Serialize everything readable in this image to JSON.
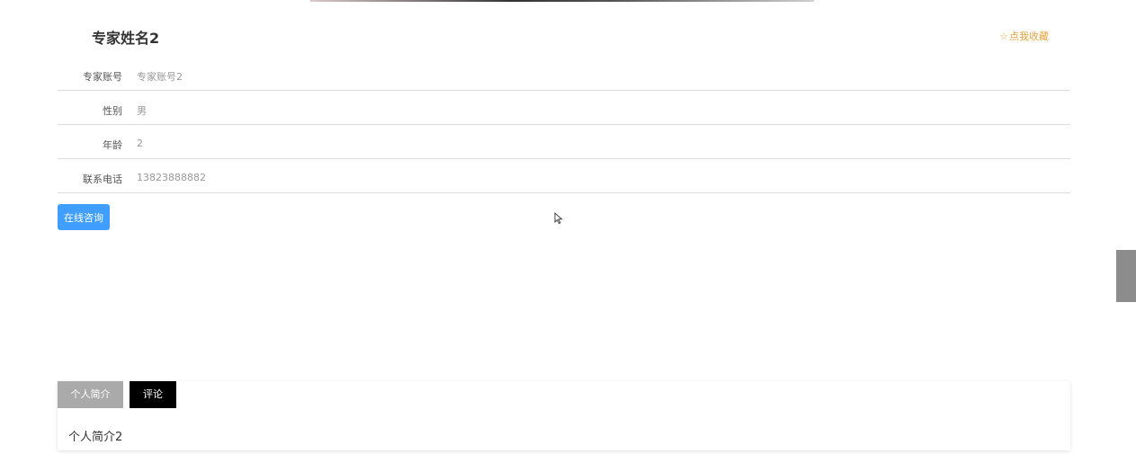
{
  "expert": {
    "title": "专家姓名2",
    "collect_label": "点我收藏",
    "collect_icon": "star-outline-icon",
    "fields": [
      {
        "label": "专家账号",
        "value": "专家账号2"
      },
      {
        "label": "性别",
        "value": "男"
      },
      {
        "label": "年龄",
        "value": "2"
      },
      {
        "label": "联系电话",
        "value": "13823888882"
      }
    ],
    "consult_button": "在线咨询"
  },
  "tabs": {
    "items": [
      {
        "label": "个人简介",
        "active": false
      },
      {
        "label": "评论",
        "active": true
      }
    ],
    "content": "个人简介2"
  },
  "colors": {
    "accent": "#409eff",
    "collect": "#e6a23c",
    "tab_inactive": "#aaaaaa",
    "tab_active": "#000000"
  }
}
